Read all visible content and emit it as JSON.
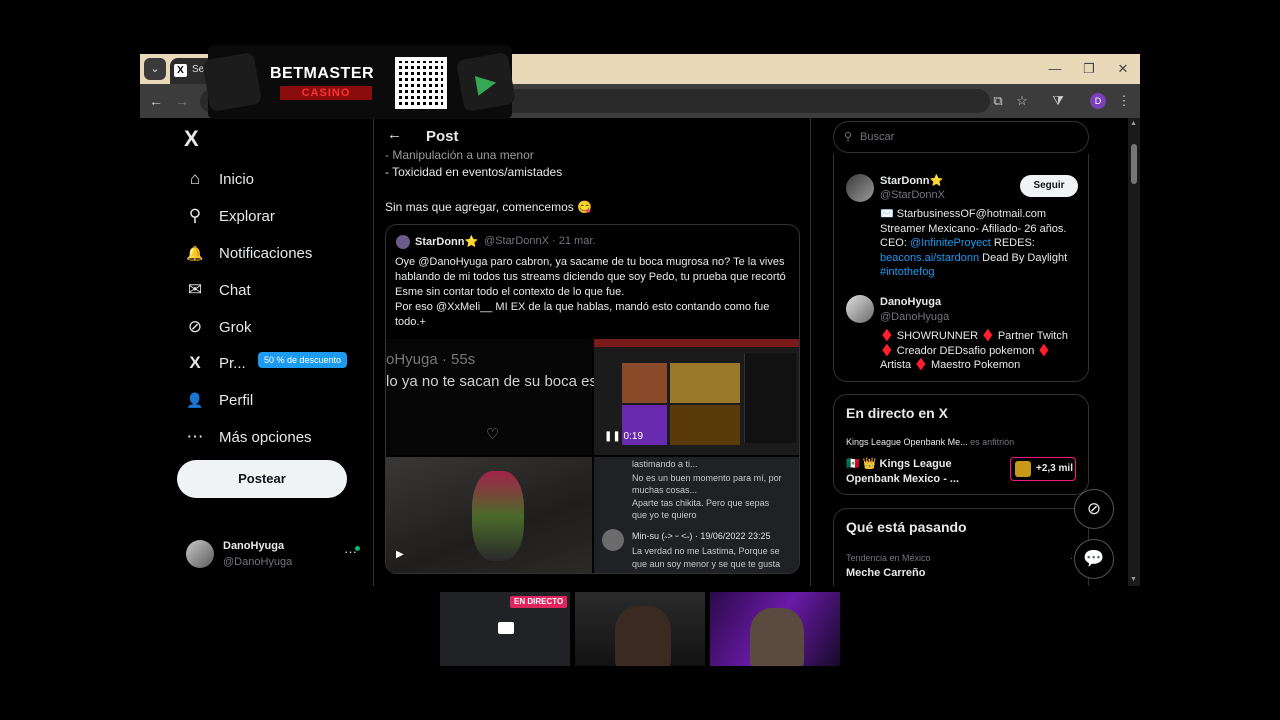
{
  "browser": {
    "tab_title": "Sel",
    "window_controls": {
      "minimize": "—",
      "maximize": "❐",
      "close": "✕"
    },
    "profile_initial": "D"
  },
  "ad": {
    "brand_top": "BETMASTER",
    "brand_bottom": "CASINO",
    "apple_icon": "apple-icon",
    "play_icon": "google-play-icon"
  },
  "nav": {
    "logo": "X",
    "items": [
      {
        "label": "Inicio",
        "icon": "home-icon",
        "glyph": "⌂"
      },
      {
        "label": "Explorar",
        "icon": "search-icon",
        "glyph": "⚲"
      },
      {
        "label": "Notificaciones",
        "icon": "bell-icon",
        "glyph": "🔔"
      },
      {
        "label": "Chat",
        "icon": "mail-icon",
        "glyph": "✉"
      },
      {
        "label": "Grok",
        "icon": "grok-icon",
        "glyph": "⊘"
      },
      {
        "label": "Pr...",
        "icon": "x-premium-icon",
        "glyph": "X"
      },
      {
        "label": "Perfil",
        "icon": "person-icon",
        "glyph": "👤"
      },
      {
        "label": "Más opciones",
        "icon": "more-icon",
        "glyph": "⋯"
      }
    ],
    "premium_badge": "50 % de descuento",
    "post_button": "Postear",
    "account": {
      "name": "DanoHyuga",
      "handle": "@DanoHyuga",
      "more": "···"
    }
  },
  "main": {
    "title": "Post",
    "lines": [
      "- Manipulación a una menor",
      "- Toxicidad en eventos/amistades",
      "Sin mas que agregar, comencemos 😋"
    ],
    "quote": {
      "name": "StarDonn⭐",
      "handle": "@StarDonnX · 21 mar.",
      "text": "Oye @DanoHyuga paro cabron, ya sacame de tu boca mugrosa no? Te la vives hablando de mi todos tus streams diciendo que soy Pedo, tu prueba que recortó Esme sin contar todo el contexto de lo que fue.\nPor eso @XxMeli__ MI EX de la que hablas, mandó esto contando como fue todo.+",
      "media1_line1": "oHyuga · 55s",
      "media1_line2": "lo ya no te sacan de su boca es",
      "video_time": "0:19",
      "chat_lines": [
        "lastimando a ti...",
        "No es un buen momento para mí, por",
        "muchas cosas...",
        "Aparte tas chikita. Pero que sepas",
        "que yo te quiero"
      ],
      "chat_user": "Min-su (˶˃ ᵕ ˂˶) · 19/06/2022 23:25",
      "chat_reply1": "La verdad no me Lastima, Porque se",
      "chat_reply2": "que aun soy menor y se que te gusta"
    }
  },
  "right": {
    "search_placeholder": "Buscar",
    "who": [
      {
        "name": "StarDonn⭐",
        "handle": "@StarDonnX",
        "follow": "Seguir",
        "bio": [
          {
            "t": "✉️ StarbusinessOF@hotmail.com"
          },
          {
            "t": "Streamer Mexicano- Afiliado- 26 años."
          },
          {
            "t": "CEO: ",
            "link": "@InfiniteProyect",
            "rest": " REDES:"
          },
          {
            "link": "beacons.ai/stardonn",
            "rest": " Dead By Daylight"
          },
          {
            "link": "#intothefog"
          }
        ]
      },
      {
        "name": "DanoHyuga",
        "handle": "@DanoHyuga",
        "bio": [
          {
            "t": "♦️ SHOWRUNNER ♦️ Partner Twitch"
          },
          {
            "t": "♦️ Creador DEDsafio pokemon ♦️"
          },
          {
            "t": "Artista ♦️ Maestro Pokemon"
          }
        ]
      }
    ],
    "live": {
      "heading": "En directo en X",
      "host": "Kings League Openbank Me...",
      "host_role": "es anfitrión",
      "title1": "🇲🇽 👑 Kings League",
      "title2": "Openbank Mexico - ...",
      "count": "+2,3 mil"
    },
    "trends": {
      "heading": "Qué está pasando",
      "sub": "Tendencia en México",
      "name": "Meche Carreño",
      "more": "···"
    }
  },
  "webcam": {
    "live_badge": "EN DIRECTO"
  },
  "colors": {
    "accent": "#1d9bf0",
    "live": "#f91880",
    "bg": "#000000"
  }
}
